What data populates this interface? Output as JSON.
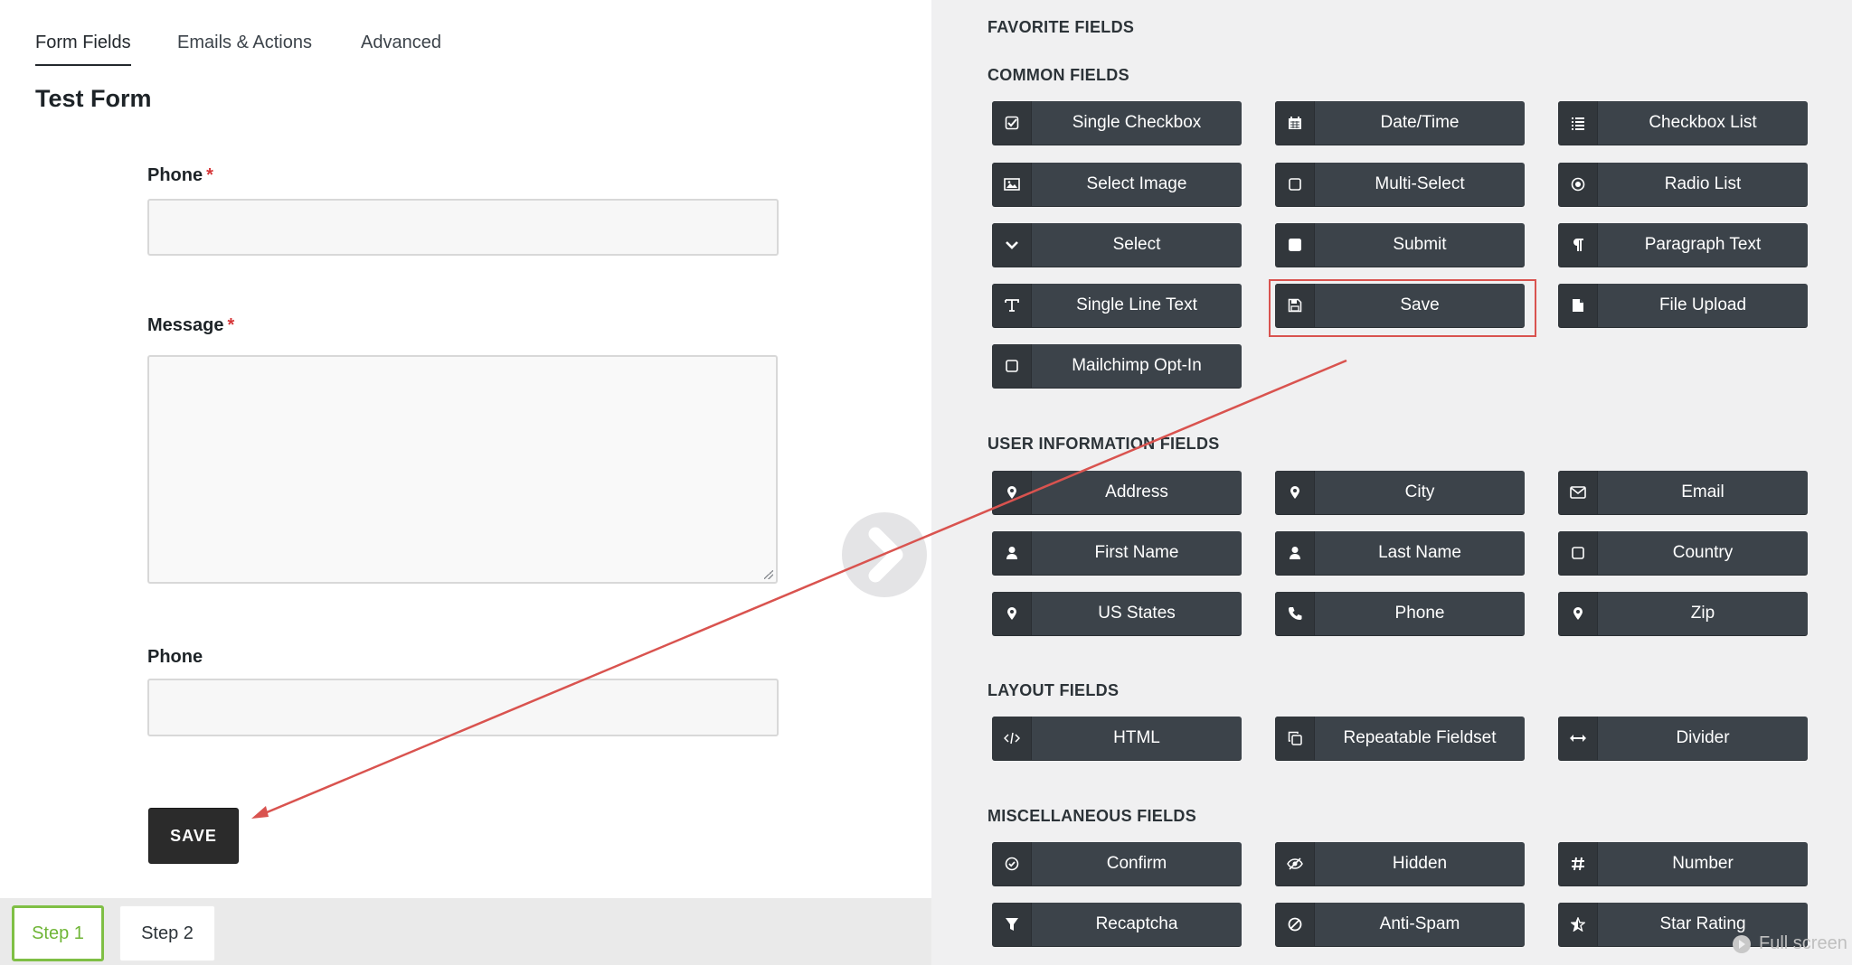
{
  "tabs": [
    "Form Fields",
    "Emails & Actions",
    "Advanced"
  ],
  "form": {
    "title": "Test Form",
    "fields": [
      {
        "label": "Phone",
        "required_mark": "*"
      },
      {
        "label": "Message",
        "required_mark": "*"
      },
      {
        "label": "Phone",
        "required_mark": ""
      }
    ],
    "save_label": "SAVE"
  },
  "steps": [
    "Step 1",
    "Step 2"
  ],
  "palette": {
    "favorite_title": "FAVORITE FIELDS",
    "common_title": "COMMON FIELDS",
    "user_info_title": "USER INFORMATION FIELDS",
    "layout_title": "LAYOUT FIELDS",
    "misc_title": "MISCELLANEOUS FIELDS",
    "common": [
      {
        "label": "Single Checkbox",
        "icon": "checkbox-checked-icon"
      },
      {
        "label": "Date/Time",
        "icon": "calendar-icon"
      },
      {
        "label": "Checkbox List",
        "icon": "list-icon"
      },
      {
        "label": "Select Image",
        "icon": "image-icon"
      },
      {
        "label": "Multi-Select",
        "icon": "square-outline-icon"
      },
      {
        "label": "Radio List",
        "icon": "radio-icon"
      },
      {
        "label": "Select",
        "icon": "chevron-down-icon"
      },
      {
        "label": "Submit",
        "icon": "square-filled-icon"
      },
      {
        "label": "Paragraph Text",
        "icon": "pilcrow-icon"
      },
      {
        "label": "Single Line Text",
        "icon": "text-icon"
      },
      {
        "label": "Save",
        "icon": "floppy-disk-icon"
      },
      {
        "label": "File Upload",
        "icon": "file-icon"
      },
      {
        "label": "Mailchimp Opt-In",
        "icon": "square-outline-icon"
      }
    ],
    "user_info": [
      {
        "label": "Address",
        "icon": "map-pin-icon"
      },
      {
        "label": "City",
        "icon": "map-pin-icon"
      },
      {
        "label": "Email",
        "icon": "envelope-icon"
      },
      {
        "label": "First Name",
        "icon": "user-icon"
      },
      {
        "label": "Last Name",
        "icon": "user-icon"
      },
      {
        "label": "Country",
        "icon": "square-outline-icon"
      },
      {
        "label": "US States",
        "icon": "map-pin-icon"
      },
      {
        "label": "Phone",
        "icon": "phone-icon"
      },
      {
        "label": "Zip",
        "icon": "map-pin-icon"
      }
    ],
    "layout": [
      {
        "label": "HTML",
        "icon": "code-icon"
      },
      {
        "label": "Repeatable Fieldset",
        "icon": "copy-icon"
      },
      {
        "label": "Divider",
        "icon": "horizontal-arrows-icon"
      }
    ],
    "misc": [
      {
        "label": "Confirm",
        "icon": "check-circle-icon"
      },
      {
        "label": "Hidden",
        "icon": "eye-slash-icon"
      },
      {
        "label": "Number",
        "icon": "hash-icon"
      },
      {
        "label": "Recaptcha",
        "icon": "filter-icon"
      },
      {
        "label": "Anti-Spam",
        "icon": "ban-icon"
      },
      {
        "label": "Star Rating",
        "icon": "star-half-icon"
      }
    ]
  },
  "fullscreen_label": "Full screen",
  "colors": {
    "accent_green": "#7fbf45",
    "annotation_red": "#d9534f",
    "button_dark": "#3c434a"
  }
}
